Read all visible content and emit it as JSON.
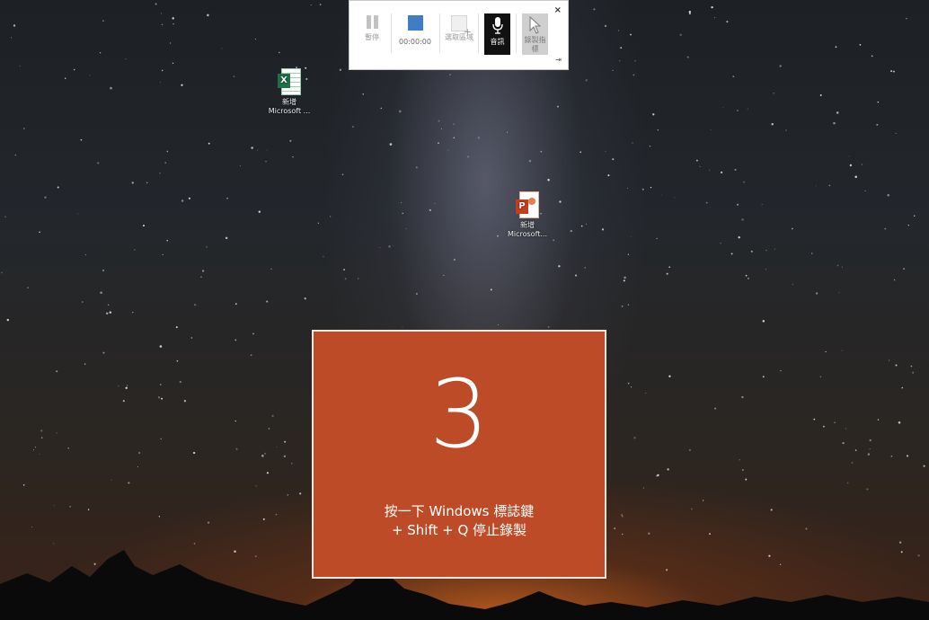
{
  "toolbar": {
    "pause_label": "暫停",
    "timer": "00:00:00",
    "select_area_label": "選取區域",
    "audio_label": "音訊",
    "record_pointer_label": "錄製指標",
    "close_glyph": "×",
    "pin_glyph": "⇥",
    "icons": [
      "pause-icon",
      "stop-icon",
      "select-area-icon",
      "microphone-icon",
      "pointer-icon",
      "close-icon",
      "pin-icon"
    ],
    "colors": {
      "stop": "#3f7ec6",
      "audio_active_bg": "#111111"
    }
  },
  "desktop": {
    "icons": [
      {
        "name": "新增",
        "subtitle": "Microsoft ...",
        "badge": "X",
        "type": "excel"
      },
      {
        "name": "新增",
        "subtitle": "Microsoft...",
        "badge": "P",
        "type": "powerpoint"
      }
    ]
  },
  "countdown": {
    "number": "3",
    "line1": "按一下 Windows 標誌鍵",
    "line2": "+ Shift + Q 停止錄製",
    "background": "#bd4b28"
  }
}
